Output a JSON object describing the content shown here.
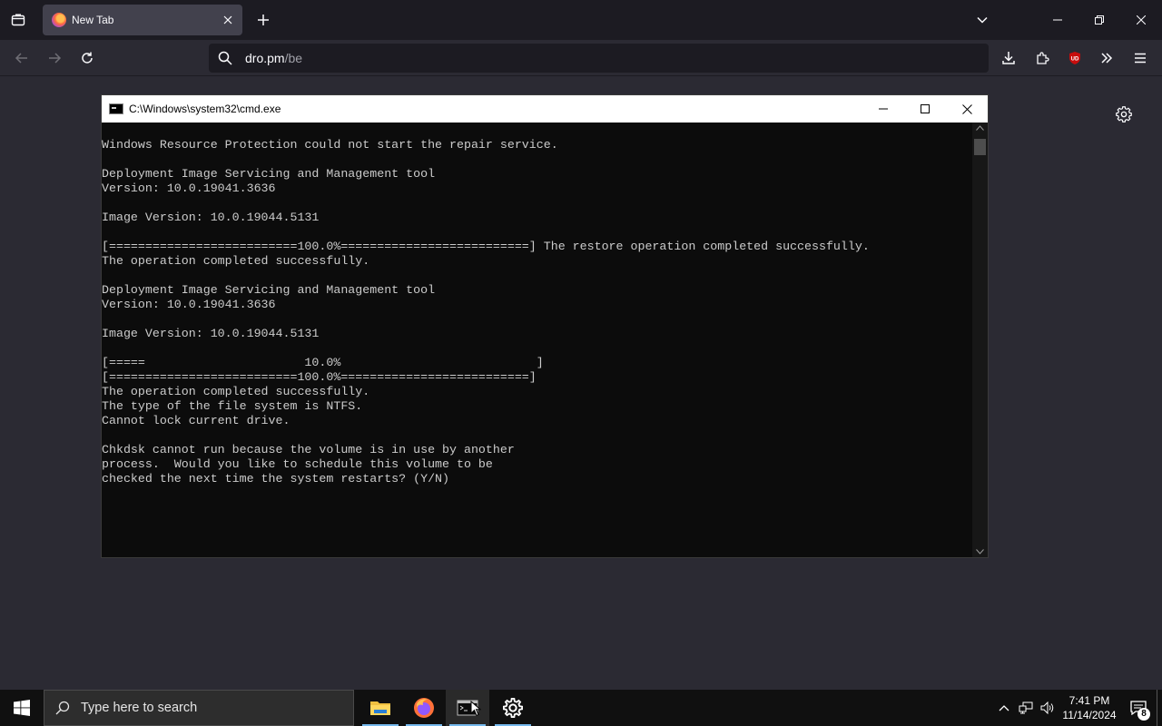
{
  "browser": {
    "tab": {
      "title": "New Tab"
    },
    "url": {
      "host": "dro.pm",
      "path": "/be"
    }
  },
  "cmd": {
    "title": "C:\\Windows\\system32\\cmd.exe",
    "lines": [
      "Windows Resource Protection could not start the repair service.",
      "",
      "Deployment Image Servicing and Management tool",
      "Version: 10.0.19041.3636",
      "",
      "Image Version: 10.0.19044.5131",
      "",
      "[==========================100.0%==========================] The restore operation completed successfully.",
      "The operation completed successfully.",
      "",
      "Deployment Image Servicing and Management tool",
      "Version: 10.0.19041.3636",
      "",
      "Image Version: 10.0.19044.5131",
      "",
      "[=====                      10.0%                           ]",
      "[==========================100.0%==========================]",
      "The operation completed successfully.",
      "The type of the file system is NTFS.",
      "Cannot lock current drive.",
      "",
      "Chkdsk cannot run because the volume is in use by another",
      "process.  Would you like to schedule this volume to be",
      "checked the next time the system restarts? (Y/N)"
    ]
  },
  "taskbar": {
    "search_placeholder": "Type here to search",
    "time": "7:41 PM",
    "date": "11/14/2024",
    "notification_count": "8",
    "apps": [
      "file-explorer",
      "firefox",
      "command-prompt",
      "settings"
    ]
  },
  "colors": {
    "browser_bg": "#2b2a33",
    "tabstrip_bg": "#1c1b22",
    "cmd_text": "#cccccc",
    "taskbar_accent": "#76b9ed"
  }
}
